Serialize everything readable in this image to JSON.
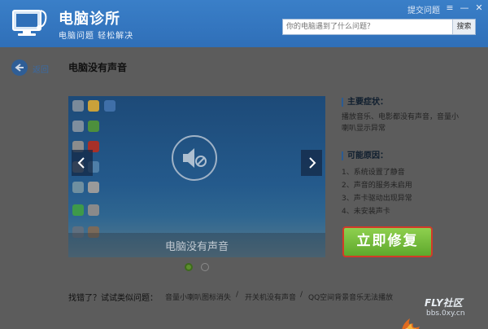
{
  "app": {
    "title": "电脑诊所",
    "slogan": "电脑问题 轻松解决",
    "feedback_link": "提交问题",
    "window_controls": [
      "≡",
      "—",
      "✕"
    ],
    "search_placeholder": "你的电脑遇到了什么问题？",
    "search_button": "搜索",
    "colors": {
      "header": "#3a7fc8",
      "accent": "#2b5b93",
      "fix_button": "#6cb834",
      "fix_border": "#d23a28"
    }
  },
  "page": {
    "back_label": "返回",
    "title": "电脑没有声音"
  },
  "preview": {
    "caption": "电脑没有声音",
    "prev_icon": "chevron-left-icon",
    "next_icon": "chevron-right-icon",
    "center_icon": "speaker-mute-icon",
    "slide_count": 2,
    "active_slide": 1
  },
  "diagnosis": {
    "symptom_heading": "主要症状：",
    "symptom_lines": [
      "播放音乐、电影都没有声音，音量小",
      "喇叭显示异常"
    ],
    "cause_heading": "可能原因：",
    "causes": [
      "1、系统设置了静音",
      "2、声音的服务未启用",
      "3、声卡驱动出现异常",
      "4、未安装声卡"
    ],
    "fix_button": "立即修复"
  },
  "related": {
    "prompt": "找错了？试试类似问题：",
    "items": [
      "音量小喇叭图标消失",
      "开关机没有声音",
      "QQ空间背景音乐无法播放"
    ],
    "separator": "/"
  },
  "watermark": {
    "brand": "FLY社区",
    "url": "bbs.0xy.cn"
  }
}
